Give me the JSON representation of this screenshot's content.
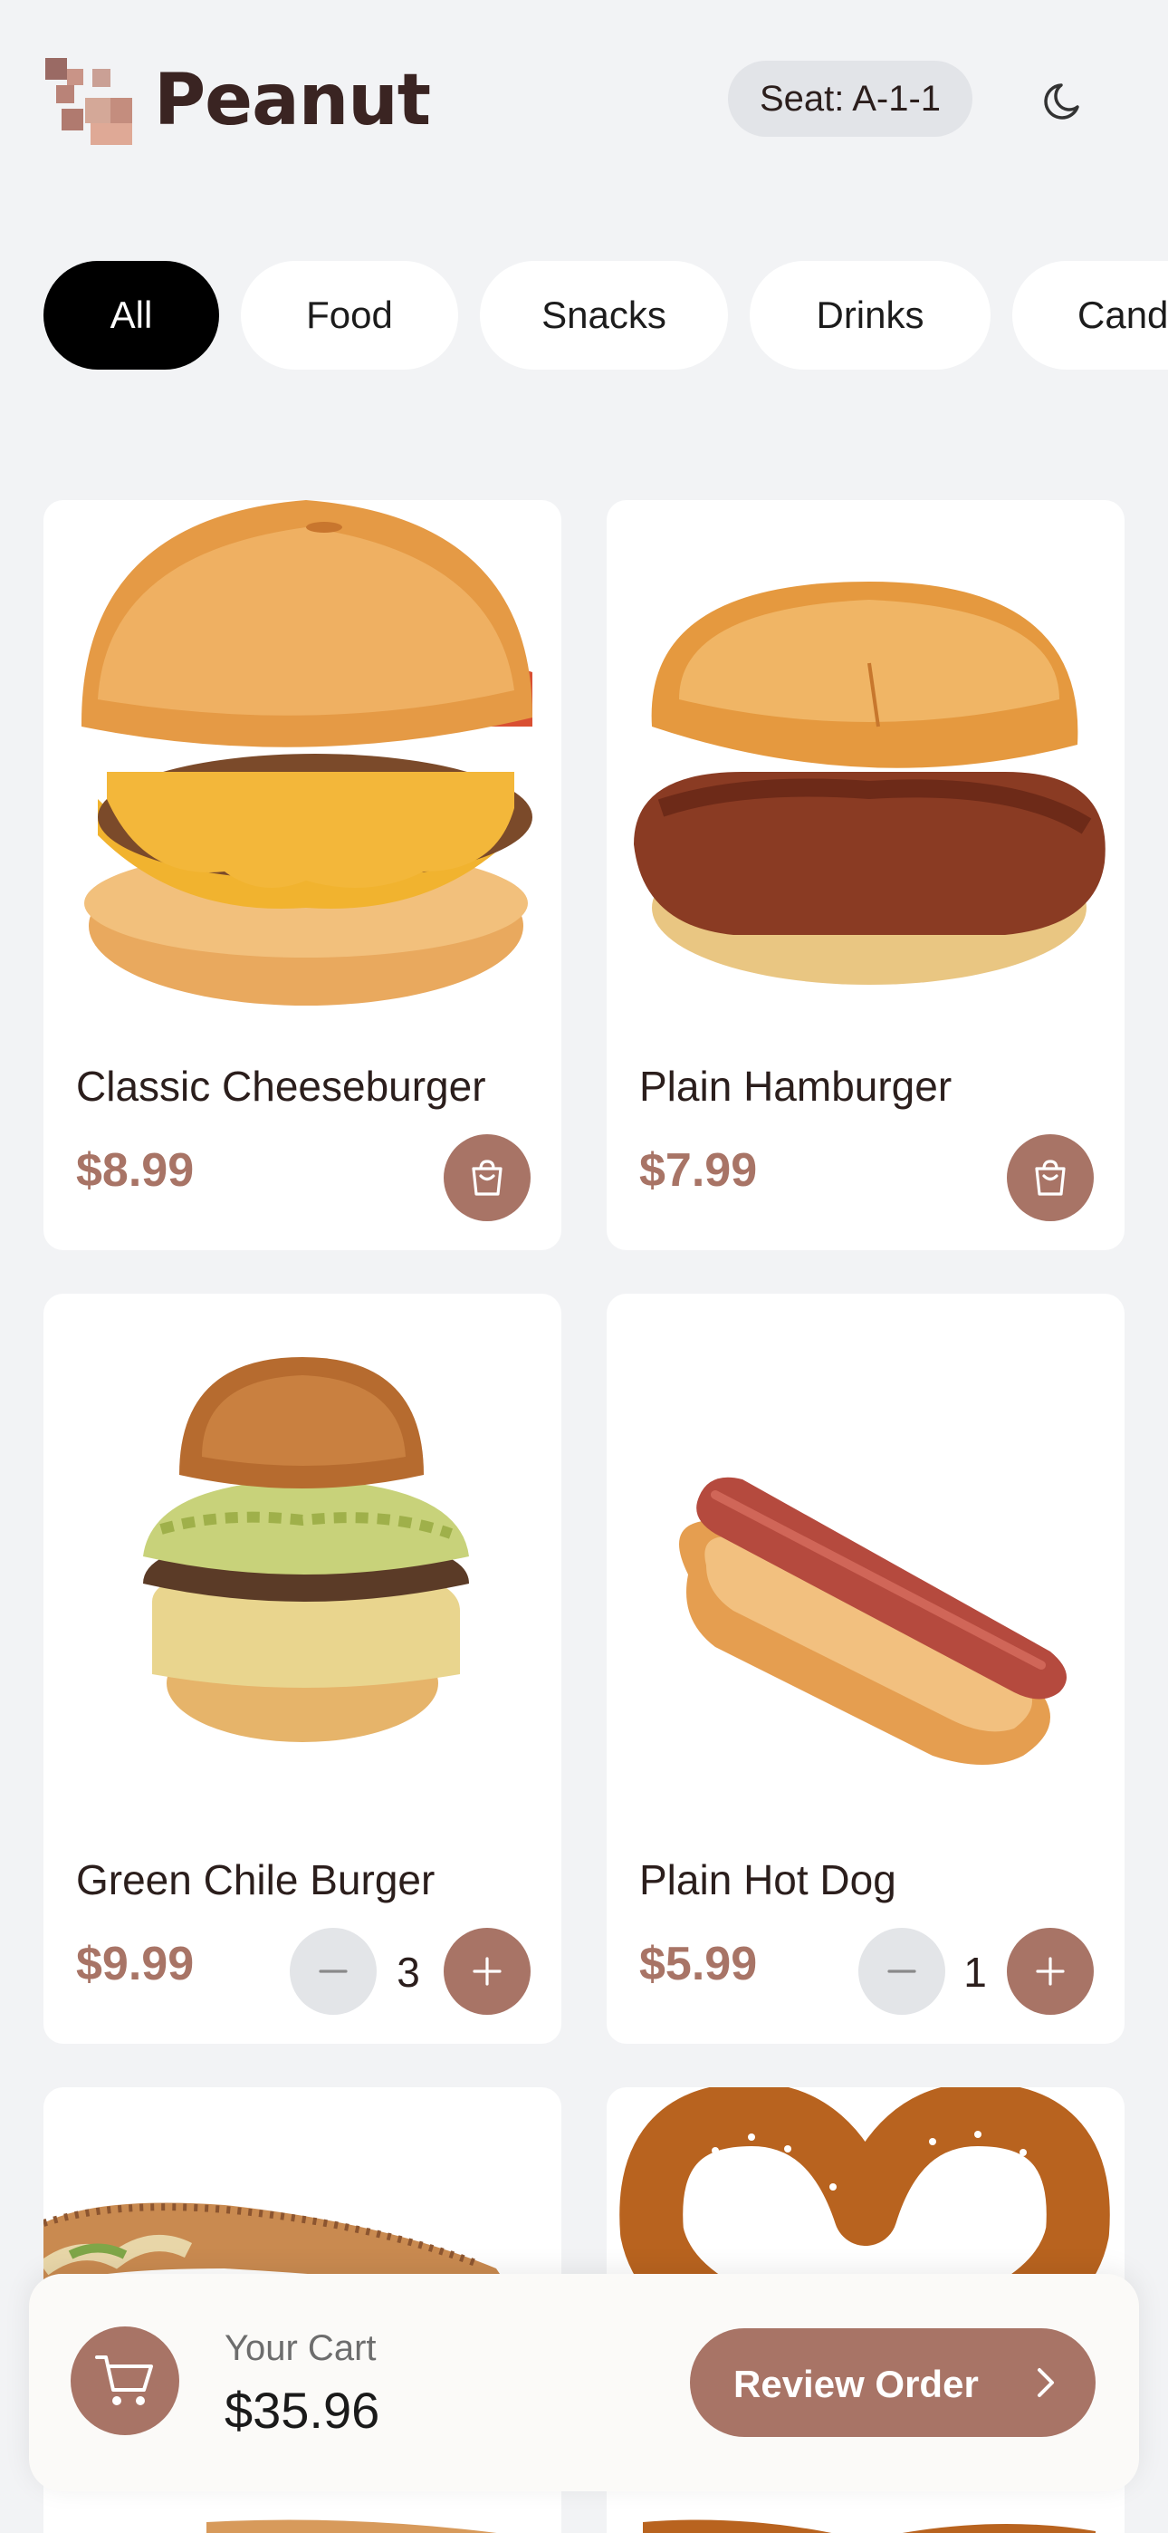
{
  "header": {
    "brand": "Peanut",
    "seat": "Seat: A-1-1",
    "theme_icon": "moon-icon"
  },
  "categories": [
    {
      "label": "All",
      "active": true
    },
    {
      "label": "Food",
      "active": false
    },
    {
      "label": "Snacks",
      "active": false
    },
    {
      "label": "Drinks",
      "active": false
    },
    {
      "label": "Candy",
      "active": false
    }
  ],
  "products": [
    {
      "name": "Classic Cheeseburger",
      "price": "$8.99",
      "image": "cheeseburger-image",
      "action": "add-to-cart-icon"
    },
    {
      "name": "Plain Hamburger",
      "price": "$7.99",
      "image": "hamburger-image",
      "action": "add-to-cart-icon"
    },
    {
      "name": "Green Chile Burger",
      "price": "$9.99",
      "image": "green-chile-burger-image",
      "quantity": "3"
    },
    {
      "name": "Plain Hot Dog",
      "price": "$5.99",
      "image": "hot-dog-image",
      "quantity": "1"
    },
    {
      "image": "loaded-hot-dog-image"
    },
    {
      "image": "pretzel-image"
    }
  ],
  "cart": {
    "label": "Your Cart",
    "total": "$35.96",
    "button": "Review Order"
  },
  "colors": {
    "accent": "#a87466",
    "background": "#f2f3f5",
    "chip_active": "#000000"
  }
}
